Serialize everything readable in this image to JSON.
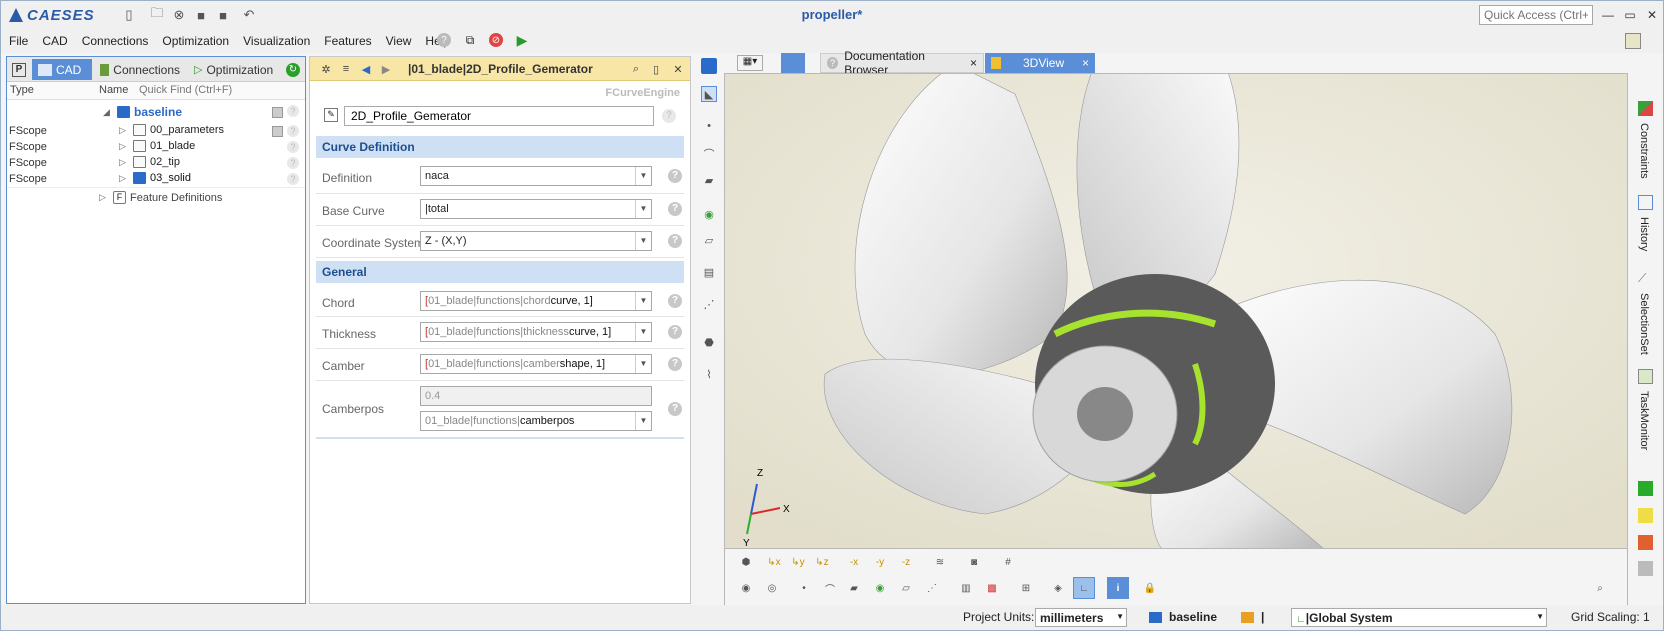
{
  "app": {
    "logo": "CAESES",
    "window_title": "propeller*",
    "quick_access_placeholder": "Quick Access (Ctrl+Q)"
  },
  "menubar": {
    "items": [
      "File",
      "CAD",
      "Connections",
      "Optimization",
      "Visualization",
      "Features",
      "View",
      "Help"
    ]
  },
  "left_panel": {
    "tabs": [
      {
        "icon": "P",
        "label": ""
      },
      {
        "label": "CAD"
      },
      {
        "label": "Connections"
      },
      {
        "label": "Optimization"
      }
    ],
    "columns": {
      "type": "Type",
      "name": "Name",
      "quick_find": "Quick Find (Ctrl+F)"
    },
    "tree": {
      "root": "baseline",
      "rows": [
        {
          "type": "FScope",
          "name": "00_parameters"
        },
        {
          "type": "FScope",
          "name": "01_blade"
        },
        {
          "type": "FScope",
          "name": "02_tip"
        },
        {
          "type": "FScope",
          "name": "03_solid"
        }
      ],
      "feature_definitions": "Feature Definitions",
      "feature_icon": "F"
    }
  },
  "editor": {
    "breadcrumb": "|01_blade|2D_Profile_Gemerator",
    "engine_label": "FCurveEngine",
    "object_name": "2D_Profile_Gemerator",
    "sections": {
      "curve_definition": "Curve Definition",
      "general": "General"
    },
    "fields": {
      "definition": {
        "label": "Definition",
        "value": "naca"
      },
      "base_curve": {
        "label": "Base Curve",
        "value": "|total"
      },
      "coordinate_system": {
        "label": "Coordinate System",
        "value": "Z - (X,Y)"
      },
      "chord": {
        "label": "Chord",
        "prefix": "[",
        "path": "01_blade|functions|chord",
        "suffix": "curve, 1]"
      },
      "thickness": {
        "label": "Thickness",
        "prefix": "[",
        "path": "01_blade|functions|thickness",
        "suffix": "curve, 1]"
      },
      "camber": {
        "label": "Camber",
        "prefix": "[",
        "path": "01_blade|functions|camber",
        "suffix": "shape, 1]"
      },
      "camberpos": {
        "label": "Camberpos",
        "value": "0.4",
        "path": "01_blade|functions|",
        "suffix": "camberpos"
      }
    },
    "help_mark": "?"
  },
  "view_tabs": [
    {
      "label": "Documentation Browser",
      "close": "×"
    },
    {
      "label": "3DView",
      "close": "×"
    }
  ],
  "right_sidebar": [
    "Constraints",
    "History",
    "SelectionSet",
    "TaskMonitor"
  ],
  "status_bar": {
    "project_units_label": "Project Units:",
    "project_units_value": "millimeters",
    "scope": "baseline",
    "scope_sep": "|",
    "coord_system": "|Global System",
    "grid_scaling": "Grid Scaling: 1"
  },
  "axis_labels": {
    "z": "Z",
    "x": "X",
    "y": "Y"
  },
  "colors": {
    "accent": "#5a8ed6",
    "highlight": "#f7e6a6",
    "section_bg": "#cfe0f5",
    "section_text": "#1d4e8f",
    "propeller_green": "#a6e22e"
  }
}
